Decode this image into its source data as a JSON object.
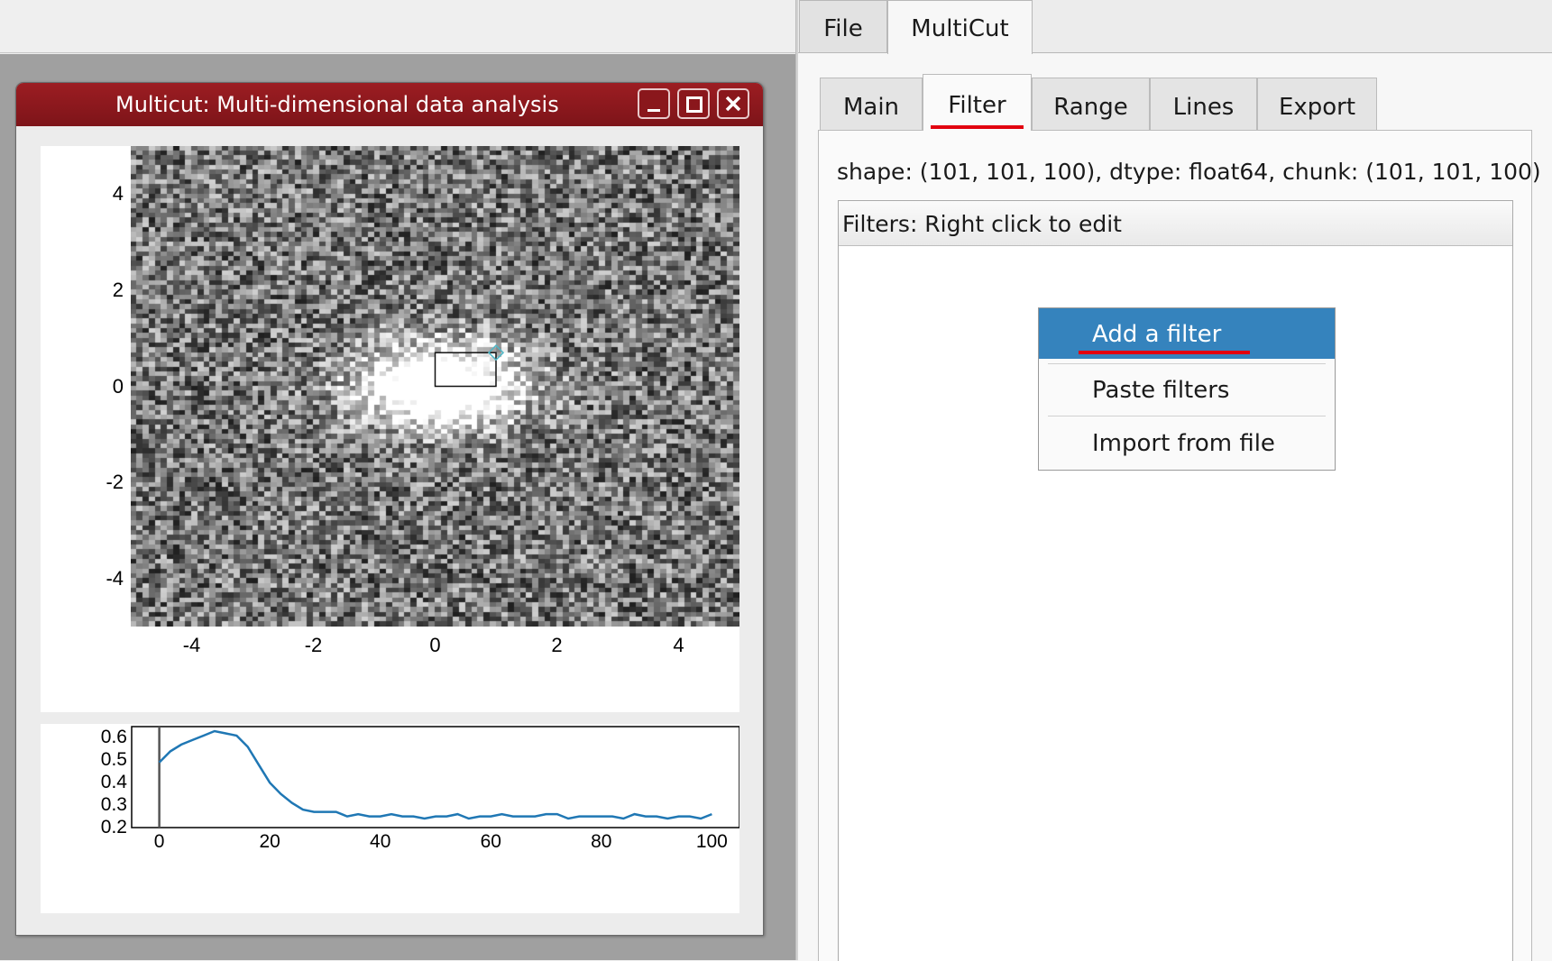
{
  "outer_tabs": [
    {
      "label": "File",
      "active": false
    },
    {
      "label": "MultiCut",
      "active": true
    }
  ],
  "window": {
    "title": "Multicut: Multi-dimensional data analysis",
    "controls": [
      "minimize-icon",
      "maximize-icon",
      "close-icon"
    ]
  },
  "inner_tabs": [
    {
      "label": "Main",
      "active": false
    },
    {
      "label": "Filter",
      "active": true
    },
    {
      "label": "Range",
      "active": false
    },
    {
      "label": "Lines",
      "active": false
    },
    {
      "label": "Export",
      "active": false
    }
  ],
  "shape_info": "shape: (101, 101, 100), dtype: float64, chunk: (101, 101, 100)",
  "filters_header": "Filters: Right click to edit",
  "context_menu": {
    "items": [
      "Add a filter",
      "Paste filters",
      "Import from file"
    ],
    "highlighted": "Add a filter",
    "highlight_color": "#3583bd"
  },
  "accent_underline_color": "#e2000f",
  "chart_data": [
    {
      "type": "heatmap",
      "title": "",
      "xlabel": "",
      "ylabel": "",
      "x_ticks": [
        "-4",
        "-2",
        "0",
        "2",
        "4"
      ],
      "y_ticks": [
        "4",
        "2",
        "0",
        "-2",
        "-4"
      ],
      "xlim": [
        -5,
        5
      ],
      "ylim": [
        -5,
        5
      ],
      "colormap": "grayscale",
      "hotspot": {
        "x": 0.1,
        "y": 0.0,
        "width": 1.4,
        "height": 0.9
      },
      "roi_box": {
        "x0": 0.0,
        "x1": 1.0,
        "y0": 0.0,
        "y1": 0.7
      }
    },
    {
      "type": "line",
      "title": "",
      "xlabel": "",
      "ylabel": "",
      "x_ticks": [
        "0",
        "20",
        "40",
        "60",
        "80",
        "100"
      ],
      "y_ticks": [
        "0.6",
        "0.5",
        "0.4",
        "0.3",
        "0.2"
      ],
      "xlim": [
        -5,
        105
      ],
      "ylim": [
        0.2,
        0.65
      ],
      "series_color": "#1f77b4",
      "marker_x": 0,
      "x": [
        0,
        2,
        4,
        6,
        8,
        10,
        12,
        14,
        16,
        18,
        20,
        22,
        24,
        26,
        28,
        30,
        32,
        34,
        36,
        38,
        40,
        42,
        44,
        46,
        48,
        50,
        52,
        54,
        56,
        58,
        60,
        62,
        64,
        66,
        68,
        70,
        72,
        74,
        76,
        78,
        80,
        82,
        84,
        86,
        88,
        90,
        92,
        94,
        96,
        98,
        100
      ],
      "values": [
        0.49,
        0.54,
        0.57,
        0.59,
        0.61,
        0.63,
        0.62,
        0.61,
        0.56,
        0.48,
        0.4,
        0.35,
        0.31,
        0.28,
        0.27,
        0.27,
        0.27,
        0.25,
        0.26,
        0.25,
        0.25,
        0.26,
        0.25,
        0.25,
        0.24,
        0.25,
        0.25,
        0.26,
        0.24,
        0.25,
        0.25,
        0.26,
        0.25,
        0.25,
        0.25,
        0.26,
        0.26,
        0.24,
        0.25,
        0.25,
        0.25,
        0.25,
        0.24,
        0.26,
        0.25,
        0.25,
        0.24,
        0.25,
        0.25,
        0.24,
        0.26
      ]
    }
  ]
}
